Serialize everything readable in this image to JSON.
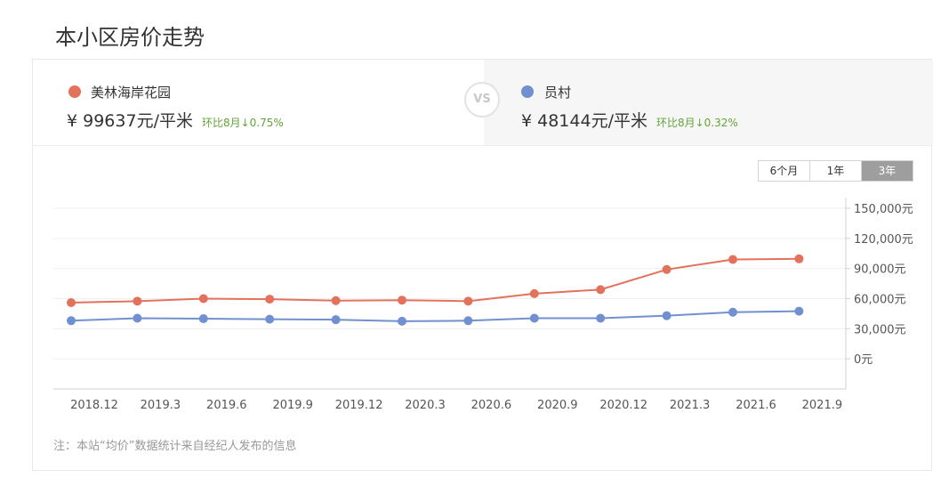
{
  "title": "本小区房价走势",
  "compare": {
    "left": {
      "name": "美林海岸花园",
      "price": "¥ 99637元/平米",
      "change": "环比8月↓0.75%",
      "color": "#e3725d"
    },
    "vs": "VS",
    "right": {
      "name": "员村",
      "price": "¥ 48144元/平米",
      "change": "环比8月↓0.32%",
      "color": "#7190d0"
    }
  },
  "range_tabs": [
    "6个月",
    "1年",
    "3年"
  ],
  "active_tab": "3年",
  "note": "注：本站“均价”数据统计来自经纪人发布的信息",
  "chart_data": {
    "type": "line",
    "categories": [
      "2018.12",
      "2019.3",
      "2019.6",
      "2019.9",
      "2019.12",
      "2020.3",
      "2020.6",
      "2020.9",
      "2020.12",
      "2021.3",
      "2021.6",
      "2021.9"
    ],
    "series": [
      {
        "name": "美林海岸花园",
        "color": "#e3725d",
        "values": [
          56000,
          57500,
          60000,
          59500,
          58000,
          58500,
          57500,
          65000,
          69000,
          89000,
          99000,
          99637
        ]
      },
      {
        "name": "员村",
        "color": "#7190d0",
        "values": [
          38000,
          40500,
          40000,
          39500,
          39000,
          37500,
          38000,
          40500,
          40500,
          43000,
          46500,
          47500
        ]
      }
    ],
    "y_ticks": [
      "150,000元",
      "120,000元",
      "90,000元",
      "60,000元",
      "30,000元",
      "0元"
    ],
    "ylim": [
      -30000,
      150000
    ],
    "grid": true
  }
}
